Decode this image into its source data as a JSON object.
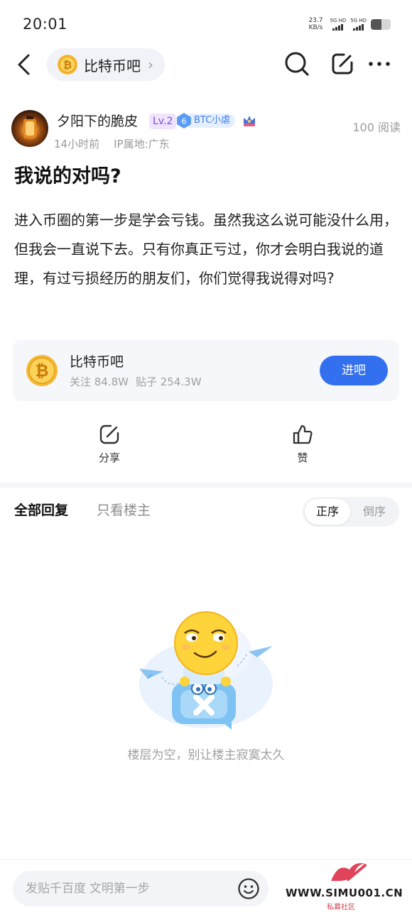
{
  "status": {
    "time": "20:01",
    "speed": "23.7",
    "speed_unit": "KB/s",
    "sim1": "5G HD",
    "sim2": "5G HD"
  },
  "nav": {
    "forum_name": "比特币吧",
    "chevron": "›",
    "icons": [
      "back-icon",
      "search-icon",
      "compose-icon",
      "more-icon"
    ]
  },
  "post": {
    "author": "夕阳下的脆皮",
    "level": "Lv.2",
    "badge_level": "6",
    "badge_name": "BTC小虐",
    "time": "14小时前",
    "ip": "IP属地:广东",
    "views": "100 阅读",
    "title": "我说的对吗?",
    "content": "进入币圈的第一步是学会亏钱。虽然我这么说可能没什么用，但我会一直说下去。只有你真正亏过，你才会明白我说的道理，有过亏损经历的朋友们，你们觉得我说得对吗?"
  },
  "forum_card": {
    "name": "比特币吧",
    "follow": "关注 84.8W",
    "posts": "贴子 254.3W",
    "button": "进吧"
  },
  "actions": {
    "share": "分享",
    "like": "赞"
  },
  "replies": {
    "tab_all": "全部回复",
    "tab_owner": "只看楼主",
    "sort_asc": "正序",
    "sort_desc": "倒序",
    "empty": "楼层为空，别让楼主寂寞太久"
  },
  "composer": {
    "placeholder": "发贴千百度 文明第一步"
  },
  "watermark": {
    "site": "WWW.SIMU001.CN",
    "sub": "私募社区"
  },
  "colors": {
    "accent": "#3370f0",
    "level": "#7a52d6",
    "badge": "#3f7dea",
    "muted": "#9a9a9a"
  }
}
